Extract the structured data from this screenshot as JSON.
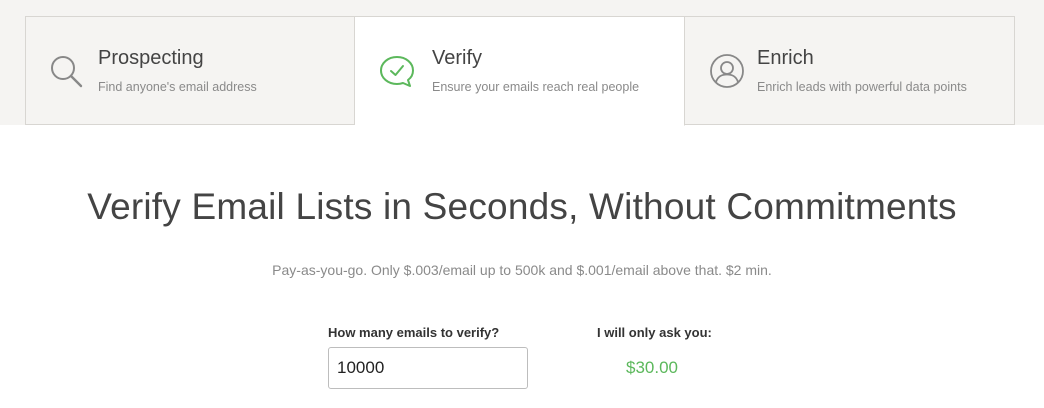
{
  "tabs": [
    {
      "title": "Prospecting",
      "description": "Find anyone's email address",
      "icon": "search-icon",
      "active": false
    },
    {
      "title": "Verify",
      "description": "Ensure your emails reach real people",
      "icon": "chat-check-icon",
      "active": true
    },
    {
      "title": "Enrich",
      "description": "Enrich leads with powerful data points",
      "icon": "user-circle-icon",
      "active": false
    }
  ],
  "headline": "Verify Email Lists in Seconds, Without Commitments",
  "pricing_note": "Pay-as-you-go. Only $.003/email up to 500k and $.001/email above that. $2 min.",
  "form": {
    "count_label": "How many emails to verify?",
    "count_value": "10000",
    "price_label": "I will only ask you:",
    "price_value": "$30.00"
  },
  "colors": {
    "accent_green": "#5cb85c",
    "band_background": "#f5f4f2",
    "icon_gray": "#888888"
  }
}
